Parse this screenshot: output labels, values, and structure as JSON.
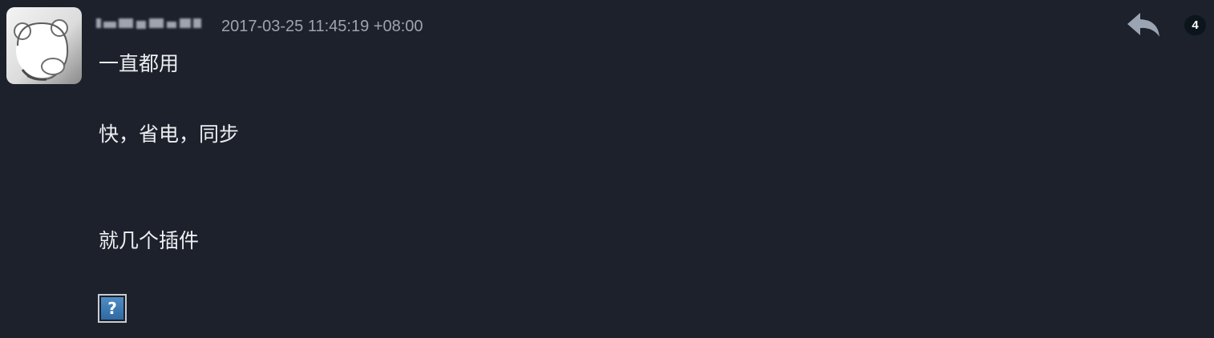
{
  "comment": {
    "author_redacted": true,
    "timestamp": "2017-03-25 11:45:19 +08:00",
    "body_lines": [
      "一直都用",
      "快，省电，同步",
      "就几个插件"
    ],
    "image_placeholder": "?"
  },
  "actions": {
    "reply_icon": "reply-icon",
    "count": "4"
  },
  "avatar_icon": "bear-avatar",
  "colors": {
    "background": "#1c212b",
    "text": "#eceef1",
    "muted_text": "#9ea4ad",
    "icon": "#9aa4b2",
    "badge_bg": "#0c141c",
    "image_blue": "#3b78b3"
  }
}
